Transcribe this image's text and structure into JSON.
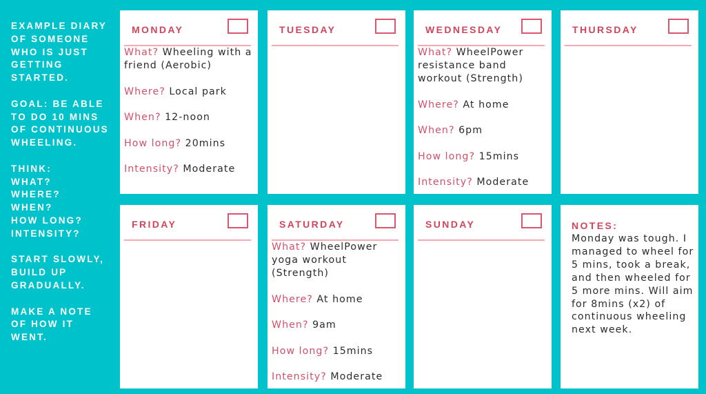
{
  "sidebar": {
    "paragraphs": [
      "EXAMPLE DIARY\nOF SOMEONE\nWHO  IS JUST\nGETTING\nSTARTED.",
      "GOAL: BE ABLE\nTO DO 10 MINS\nOF CONTINUOUS\nWHEELING.",
      "THINK:\nWHAT?\nWHERE?\nWHEN?\nHOW LONG?\nINTENSITY?",
      "START SLOWLY,\nBUILD UP\nGRADUALLY.",
      "MAKE A NOTE\nOF HOW IT\nWENT."
    ]
  },
  "labels": {
    "what": "What?",
    "where": "Where?",
    "when": "When?",
    "how_long": "How long?",
    "intensity": "Intensity?"
  },
  "colors": {
    "background": "#00c2cb",
    "heading": "#d0455e",
    "label": "#d0506a",
    "divider": "#f7a8b5"
  },
  "days": [
    {
      "name": "MONDAY",
      "what": "Wheeling with a friend (Aerobic)",
      "where": "Local park",
      "when": "12-noon",
      "how_long": "20mins",
      "intensity": "Moderate"
    },
    {
      "name": "TUESDAY"
    },
    {
      "name": "WEDNESDAY",
      "what": "WheelPower resistance band workout (Strength)",
      "where": "At home",
      "when": "6pm",
      "how_long": "15mins",
      "intensity": "Moderate"
    },
    {
      "name": "THURSDAY"
    },
    {
      "name": "FRIDAY"
    },
    {
      "name": "SATURDAY",
      "what": "WheelPower yoga workout (Strength)",
      "where": "At home",
      "when": "9am",
      "how_long": "15mins",
      "intensity": "Moderate"
    },
    {
      "name": "SUNDAY"
    }
  ],
  "notes": {
    "title": "NOTES:",
    "body": "Monday was tough. I managed to wheel for 5 mins, took a break, and then wheeled for 5 more mins. Will aim for 8mins (x2) of continuous wheeling next week."
  }
}
